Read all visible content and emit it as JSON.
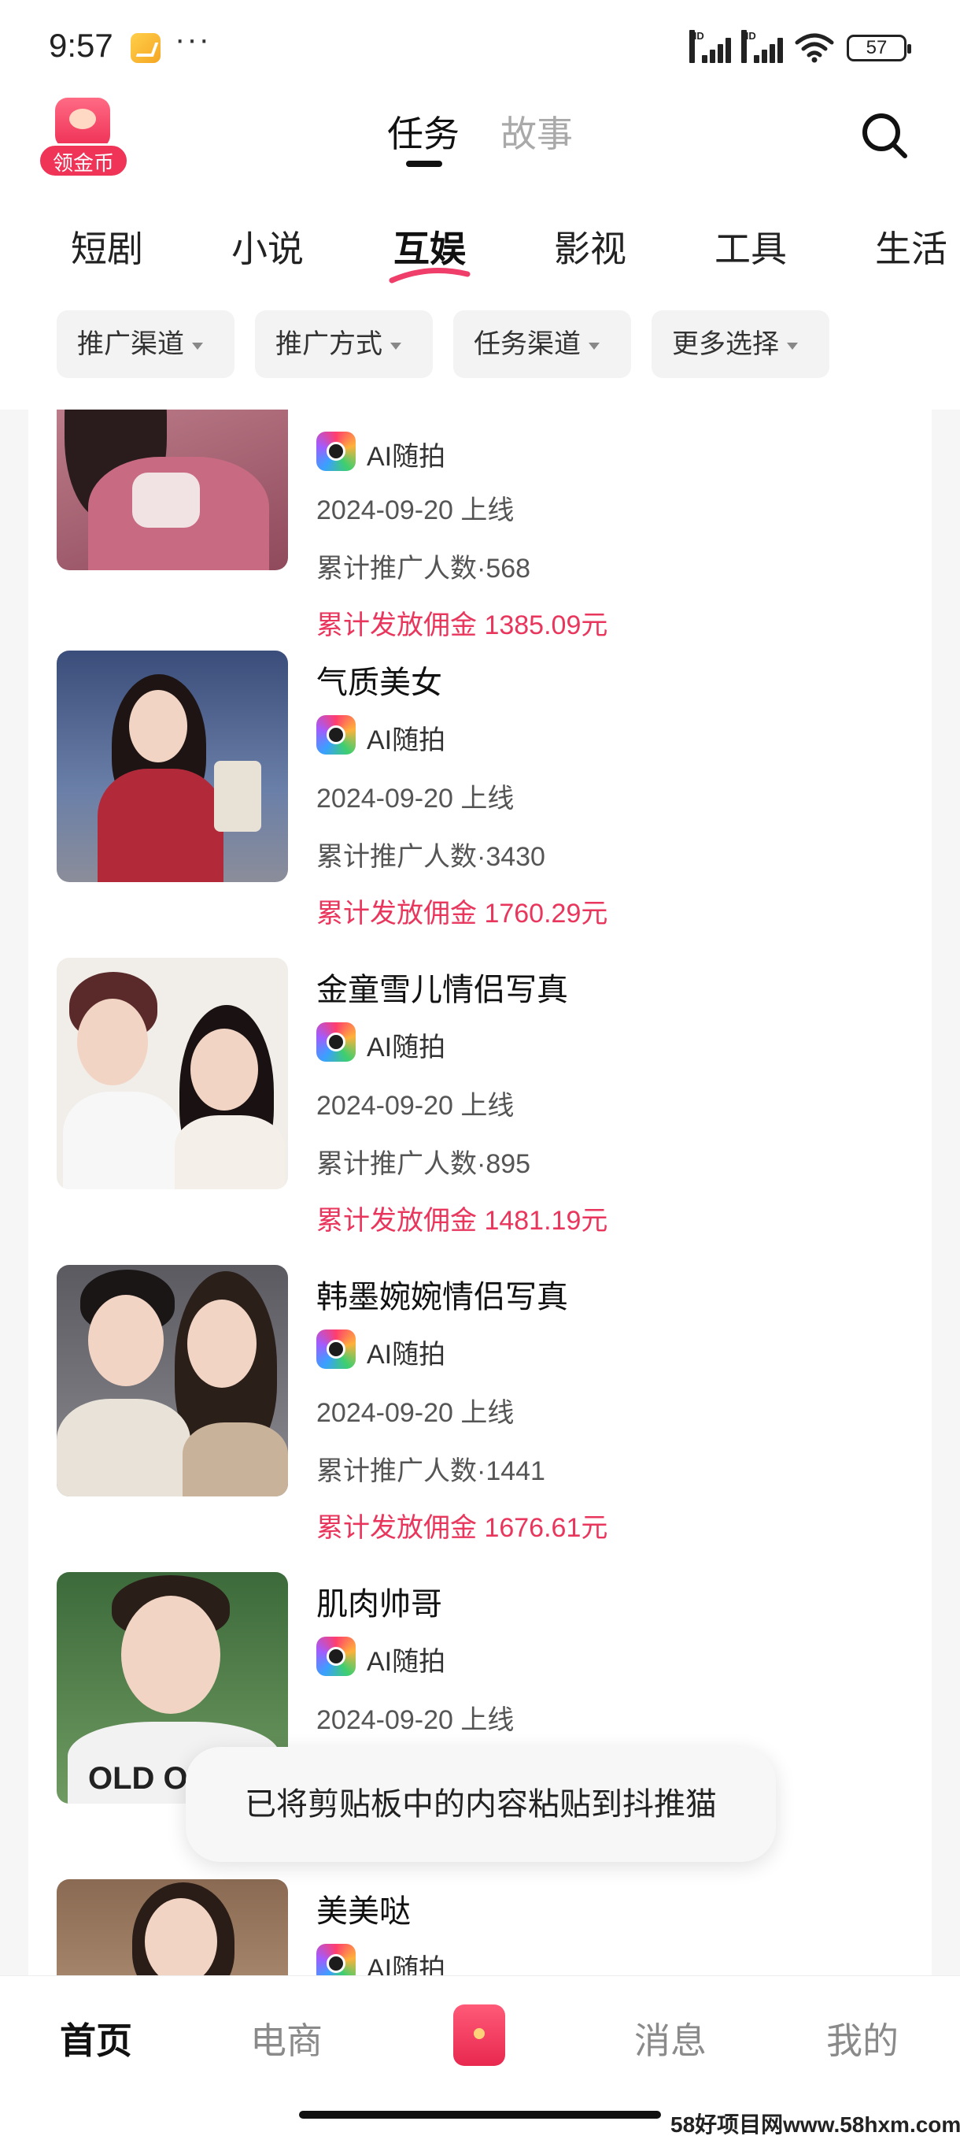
{
  "status_bar": {
    "time": "9:57",
    "dots": "···",
    "signal1": "HD",
    "signal2": "HD",
    "battery": "57"
  },
  "header": {
    "coin_label": "领金币",
    "tabs": [
      {
        "label": "任务",
        "active": true
      },
      {
        "label": "故事",
        "active": false
      }
    ]
  },
  "categories": [
    {
      "label": "短剧"
    },
    {
      "label": "小说"
    },
    {
      "label": "互娱",
      "active": true
    },
    {
      "label": "影视"
    },
    {
      "label": "工具"
    },
    {
      "label": "生活"
    }
  ],
  "filters": [
    {
      "label": "推广渠道"
    },
    {
      "label": "推广方式"
    },
    {
      "label": "任务渠道"
    },
    {
      "label": "更多选择"
    }
  ],
  "items": [
    {
      "title": "",
      "app": "AI随拍",
      "date": "2024-09-20 上线",
      "promoters": "累计推广人数·568",
      "commission": "累计发放佣金 1385.09元"
    },
    {
      "title": "气质美女",
      "app": "AI随拍",
      "date": "2024-09-20 上线",
      "promoters": "累计推广人数·3430",
      "commission": "累计发放佣金 1760.29元"
    },
    {
      "title": "金童雪儿情侣写真",
      "app": "AI随拍",
      "date": "2024-09-20 上线",
      "promoters": "累计推广人数·895",
      "commission": "累计发放佣金 1481.19元"
    },
    {
      "title": "韩墨婉婉情侣写真",
      "app": "AI随拍",
      "date": "2024-09-20 上线",
      "promoters": "累计推广人数·1441",
      "commission": "累计发放佣金 1676.61元"
    },
    {
      "title": "肌肉帅哥",
      "app": "AI随拍",
      "date": "2024-09-20 上线",
      "promoters": "",
      "commission": ""
    },
    {
      "title": "美美哒",
      "app": "AI随拍",
      "date": "",
      "promoters": "",
      "commission": ""
    }
  ],
  "thumb_texts": {
    "shirt_print": "OLD O"
  },
  "toast": "已将剪贴板中的内容粘贴到抖推猫",
  "bottom_nav": [
    {
      "label": "首页",
      "active": true
    },
    {
      "label": "电商"
    },
    {
      "label": "消息"
    },
    {
      "label": "我的"
    }
  ],
  "watermark": "58好项目网www.58hxm.com",
  "colors": {
    "accent": "#e8365d",
    "active_text": "#111111",
    "inactive_text": "#a9a9a9"
  }
}
